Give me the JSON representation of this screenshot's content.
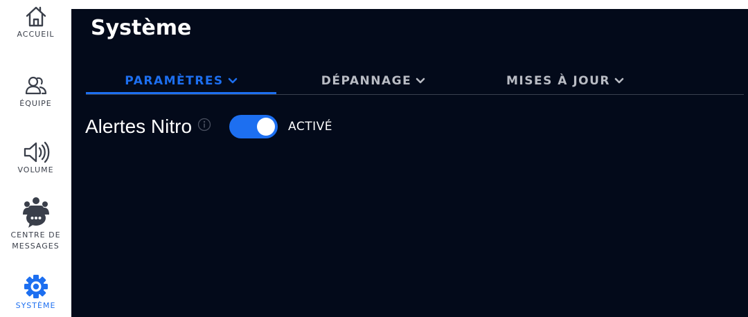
{
  "sidebar": {
    "items": [
      {
        "label": "ACCUEIL",
        "icon": "home-icon"
      },
      {
        "label": "ÉQUIPE",
        "icon": "team-icon"
      },
      {
        "label": "VOLUME",
        "icon": "volume-icon"
      },
      {
        "label": "CENTRE DE\nMESSAGES",
        "icon": "message-center-icon"
      },
      {
        "label": "SYSTÈME",
        "icon": "gear-icon",
        "active": true
      }
    ]
  },
  "main": {
    "title": "Système",
    "tabs": [
      {
        "label": "PARAMÈTRES",
        "active": true
      },
      {
        "label": "DÉPANNAGE"
      },
      {
        "label": "MISES À JOUR"
      }
    ],
    "settings": [
      {
        "label": "Alertes Nitro",
        "enabled": true,
        "state_label": "ACTIVÉ"
      }
    ]
  },
  "colors": {
    "accent": "#1d6ff0",
    "panel_background": "#030a1a",
    "sidebar_text": "#3a3f4a",
    "tab_text": "#b9bcc4"
  }
}
